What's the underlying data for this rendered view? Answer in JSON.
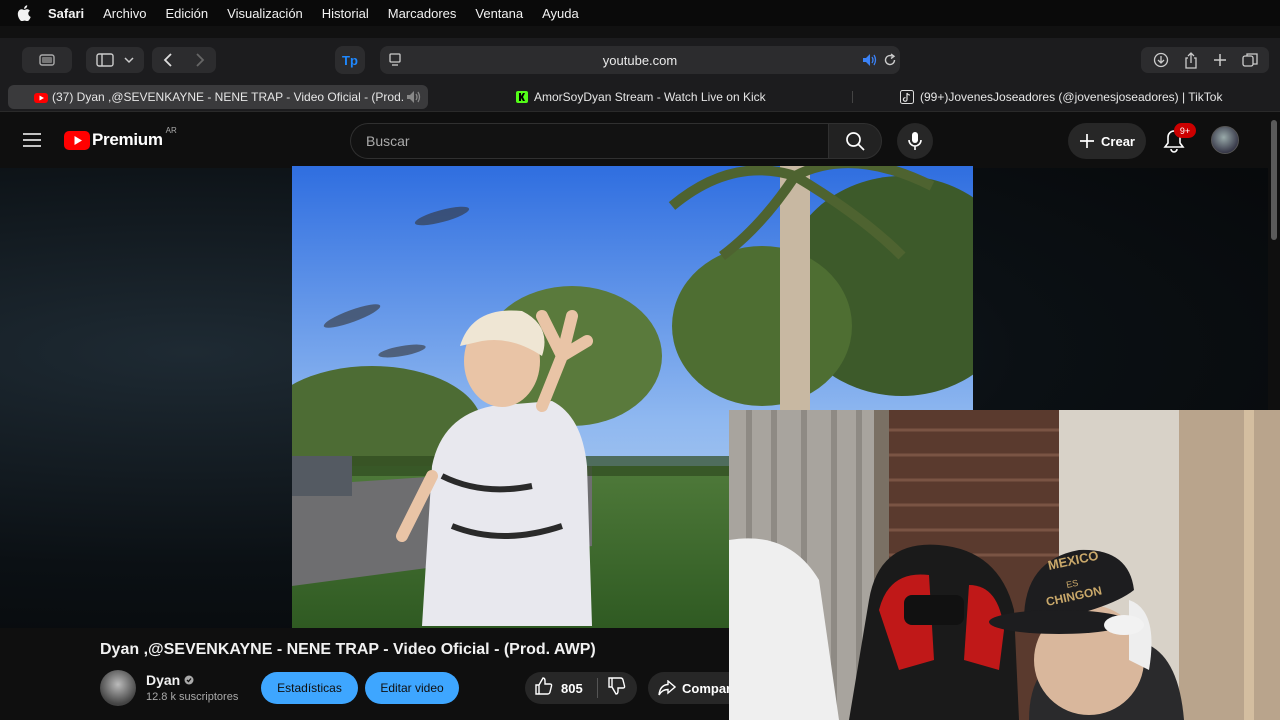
{
  "menubar": {
    "apple": "apple-icon",
    "items": [
      "Safari",
      "Archivo",
      "Edición",
      "Visualización",
      "Historial",
      "Marcadores",
      "Ventana",
      "Ayuda"
    ]
  },
  "toolbar": {
    "url": "youtube.com"
  },
  "tabs": [
    {
      "label": "(37) Dyan ,@SEVENKAYNE - NENE TRAP - Video Oficial - (Prod...",
      "icon": "youtube-icon",
      "active": true
    },
    {
      "label": "AmorSoyDyan Stream - Watch Live on Kick",
      "icon": "kick-icon",
      "active": false
    },
    {
      "label": "(99+)JovenesJoseadores (@jovenesjoseadores) | TikTok",
      "icon": "tiktok-icon",
      "active": false
    }
  ],
  "youtube": {
    "logo_text": "Premium",
    "country": "AR",
    "search_placeholder": "Buscar",
    "create_label": "Crear",
    "notifications_badge": "9+",
    "colors": {
      "brand_red": "#ff0000",
      "accent_blue": "#3ea6ff",
      "badge_red": "#cc0000"
    }
  },
  "video": {
    "title": "Dyan ,@SEVENKAYNE - NENE TRAP - Video Oficial - (Prod. AWP)",
    "channel": "Dyan",
    "subscribers": "12.8 k suscriptores",
    "stats_button": "Estadísticas",
    "edit_button": "Editar video",
    "likes": "805",
    "share_label": "Compar"
  }
}
